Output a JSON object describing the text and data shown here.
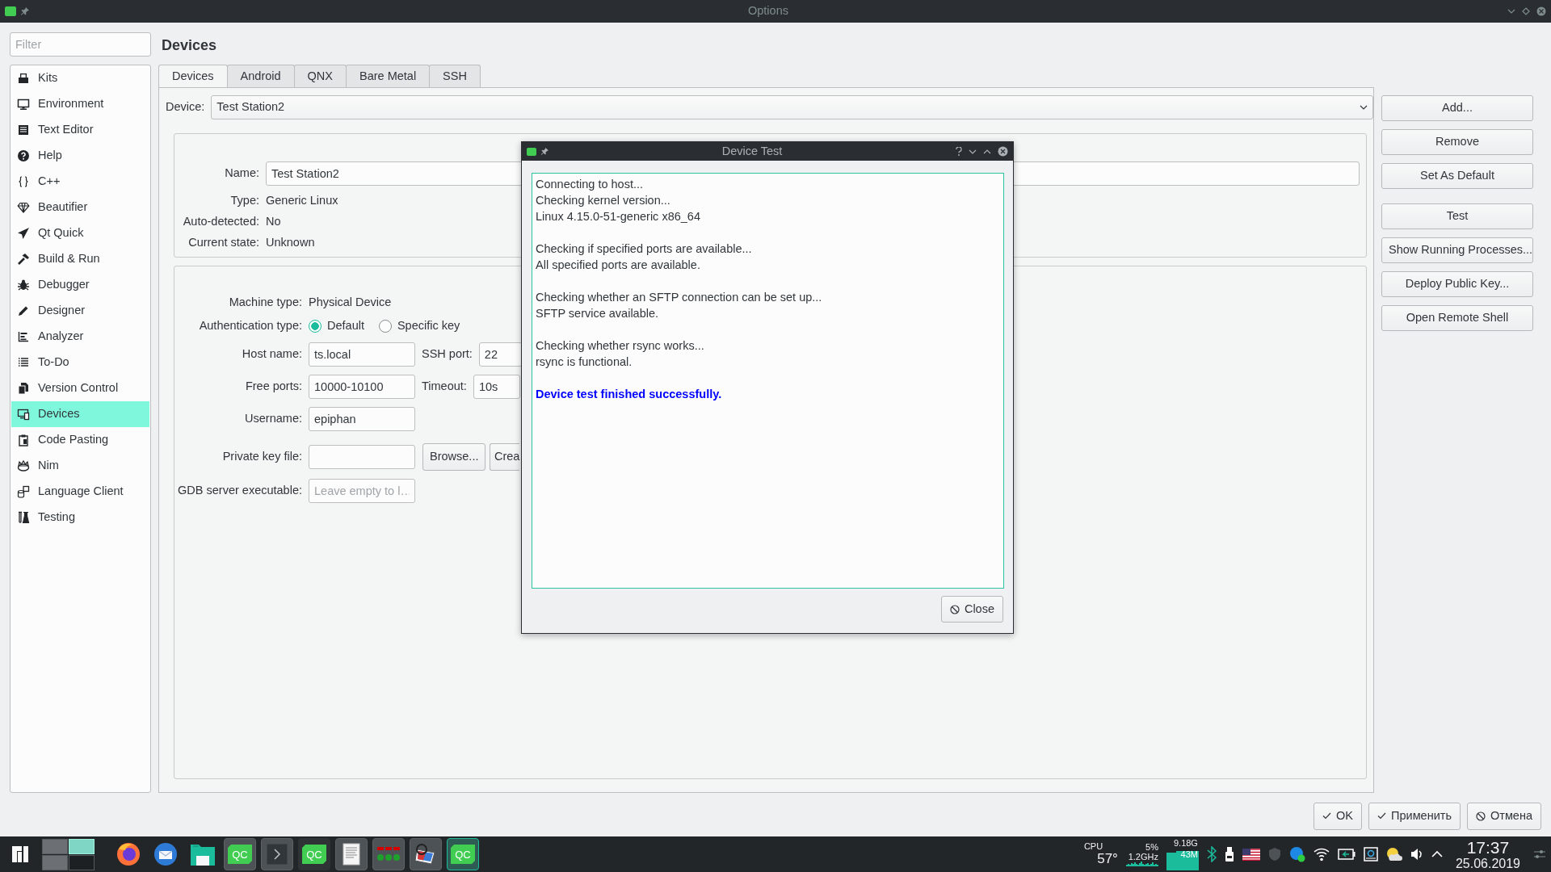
{
  "window": {
    "title": "Options"
  },
  "filter": {
    "placeholder": "Filter"
  },
  "sidebar": {
    "items": [
      {
        "label": "Kits",
        "selected": false
      },
      {
        "label": "Environment",
        "selected": false
      },
      {
        "label": "Text Editor",
        "selected": false
      },
      {
        "label": "Help",
        "selected": false
      },
      {
        "label": "C++",
        "selected": false
      },
      {
        "label": "Beautifier",
        "selected": false
      },
      {
        "label": "Qt Quick",
        "selected": false
      },
      {
        "label": "Build & Run",
        "selected": false
      },
      {
        "label": "Debugger",
        "selected": false
      },
      {
        "label": "Designer",
        "selected": false
      },
      {
        "label": "Analyzer",
        "selected": false
      },
      {
        "label": "To-Do",
        "selected": false
      },
      {
        "label": "Version Control",
        "selected": false
      },
      {
        "label": "Devices",
        "selected": true
      },
      {
        "label": "Code Pasting",
        "selected": false
      },
      {
        "label": "Nim",
        "selected": false
      },
      {
        "label": "Language Client",
        "selected": false
      },
      {
        "label": "Testing",
        "selected": false
      }
    ]
  },
  "page_title": "Devices",
  "tabs": [
    {
      "label": "Devices",
      "selected": true
    },
    {
      "label": "Android",
      "selected": false
    },
    {
      "label": "QNX",
      "selected": false
    },
    {
      "label": "Bare Metal",
      "selected": false
    },
    {
      "label": "SSH",
      "selected": false
    }
  ],
  "device": {
    "label": "Device:",
    "value": "Test Station2"
  },
  "general": {
    "name": {
      "label": "Name:",
      "value": "Test Station2"
    },
    "info": [
      {
        "label": "Type:",
        "value": "Generic Linux"
      },
      {
        "label": "Auto-detected:",
        "value": "No"
      },
      {
        "label": "Current state:",
        "value": "Unknown"
      }
    ]
  },
  "connection": {
    "machine_type": {
      "label": "Machine type:",
      "value": "Physical Device"
    },
    "auth": {
      "label": "Authentication type:",
      "options": [
        {
          "label": "Default",
          "selected": true
        },
        {
          "label": "Specific key",
          "selected": false
        }
      ]
    },
    "host_name": {
      "label": "Host name:",
      "value": "ts.local"
    },
    "ssh_port": {
      "label": "SSH port:",
      "value": "22"
    },
    "free_ports": {
      "label": "Free ports:",
      "value": "10000-10100"
    },
    "timeout": {
      "label": "Timeout:",
      "value": "10s"
    },
    "username": {
      "label": "Username:",
      "value": "epiphan"
    },
    "private_key": {
      "label": "Private key file:",
      "buttons": [
        "Browse...",
        "Crea"
      ]
    },
    "gdb_server": {
      "label": "GDB server executable:",
      "placeholder": "Leave empty to l…"
    }
  },
  "actions": [
    [
      "Add...",
      "Remove",
      "Set As Default"
    ],
    [
      "Test",
      "Show Running Processes...",
      "Deploy Public Key...",
      "Open Remote Shell"
    ]
  ],
  "dialog": {
    "title": "Device Test",
    "log": [
      [
        "Connecting to host...",
        "Checking kernel version...",
        "Linux 4.15.0-51-generic x86_64"
      ],
      [
        "Checking if specified ports are available...",
        "All specified ports are available."
      ],
      [
        "Checking whether an SFTP connection can be set up...",
        "SFTP service available."
      ],
      [
        "Checking whether rsync works...",
        "rsync is functional."
      ]
    ],
    "result": {
      "text": "Device test finished successfully.",
      "success": true
    },
    "close": "Close"
  },
  "footer": [
    {
      "label": "OK",
      "kind": "confirm"
    },
    {
      "label": "Применить",
      "kind": "confirm"
    },
    {
      "label": "Отмена",
      "kind": "cancel"
    }
  ],
  "taskbar": {
    "desktops": [
      {
        "selected": false,
        "occupied": true
      },
      {
        "selected": true,
        "occupied": true
      },
      {
        "selected": false,
        "occupied": true
      },
      {
        "selected": false,
        "occupied": false
      }
    ],
    "apps": [
      {
        "kind": "browser",
        "open": false,
        "minimized": false,
        "active": false
      },
      {
        "kind": "mail",
        "open": false,
        "minimized": false,
        "active": false
      },
      {
        "kind": "files",
        "open": false,
        "minimized": false,
        "active": false
      },
      {
        "kind": "qc",
        "text": "QC",
        "open": true,
        "minimized": false,
        "active": false
      },
      {
        "kind": "terminal",
        "open": true,
        "minimized": false,
        "active": false
      },
      {
        "kind": "qc",
        "text": "QC",
        "open": true,
        "minimized": true,
        "active": false
      },
      {
        "kind": "editor",
        "open": true,
        "minimized": false,
        "active": false
      },
      {
        "kind": "lights",
        "open": true,
        "minimized": false,
        "active": false
      },
      {
        "kind": "palette",
        "open": true,
        "minimized": false,
        "active": false
      },
      {
        "kind": "qc",
        "text": "QC",
        "open": true,
        "minimized": false,
        "active": true
      }
    ],
    "cpu": {
      "label": "CPU",
      "temperature": "57°",
      "load": "5%",
      "frequency": "1.2GHz"
    },
    "memory": {
      "total": "9.18G",
      "used": "43M"
    },
    "clock": {
      "time": "17:37",
      "date": "25.06.2019"
    }
  }
}
